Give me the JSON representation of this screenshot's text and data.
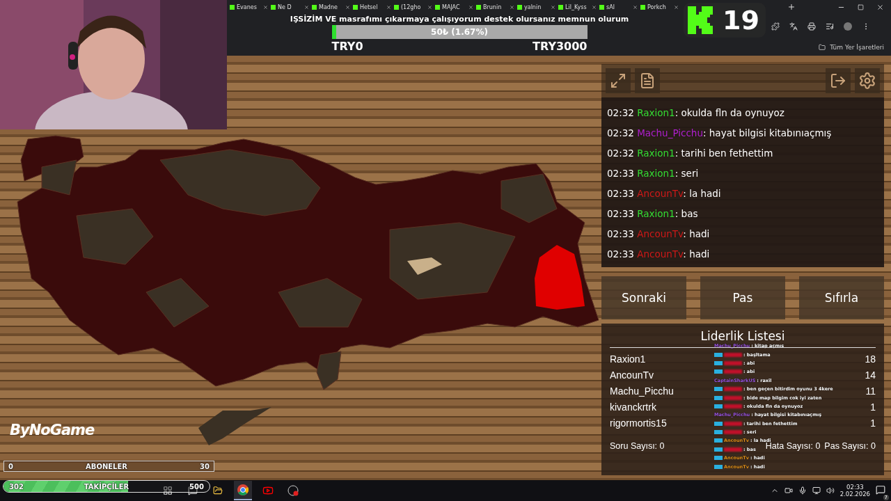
{
  "browser": {
    "tabs": [
      {
        "label": "Evanes"
      },
      {
        "label": "Ne D"
      },
      {
        "label": "Madne"
      },
      {
        "label": "Hetsel"
      },
      {
        "label": "(12gho"
      },
      {
        "label": "MAJAC"
      },
      {
        "label": "Brunin"
      },
      {
        "label": "yalnin"
      },
      {
        "label": "Lil_Kyss"
      },
      {
        "label": "sAl"
      },
      {
        "label": "Porkch"
      }
    ],
    "bookmarks": "Tüm Yer İşaretleri"
  },
  "donation": {
    "title": "IŞSİZİM VE masrafımı çıkarmaya çalışıyorum destek olursanız memnun olurum",
    "reading": "50₺ (1.67%)",
    "level": 0.0167,
    "min": "TRY0",
    "max": "TRY3000"
  },
  "viewer_badge": {
    "count": "19"
  },
  "chat": [
    {
      "time": "02:32",
      "user": "Raxion1",
      "color": "#33dd33",
      "text": ": okulda fln da oynuyoz"
    },
    {
      "time": "02:32",
      "user": "Machu_Picchu",
      "color": "#b01fd0",
      "text": ": hayat bilgisi kitabınıaçmış"
    },
    {
      "time": "02:32",
      "user": "Raxion1",
      "color": "#33dd33",
      "text": ": tarihi ben fethettim"
    },
    {
      "time": "02:33",
      "user": "Raxion1",
      "color": "#33dd33",
      "text": ": seri"
    },
    {
      "time": "02:33",
      "user": "AncounTv",
      "color": "#d01818",
      "text": ": la hadi"
    },
    {
      "time": "02:33",
      "user": "Raxion1",
      "color": "#33dd33",
      "text": ": bas"
    },
    {
      "time": "02:33",
      "user": "AncounTv",
      "color": "#d01818",
      "text": ": hadi"
    },
    {
      "time": "02:33",
      "user": "AncounTv",
      "color": "#d01818",
      "text": ": hadi"
    }
  ],
  "buttons": [
    "Sonraki",
    "Pas",
    "Sıfırla"
  ],
  "leaderboard": {
    "title": "Liderlik Listesi",
    "rows": [
      {
        "name": "Raxion1",
        "score": "18"
      },
      {
        "name": "AncounTv",
        "score": "14"
      },
      {
        "name": "Machu_Picchu",
        "score": "11"
      },
      {
        "name": "kivanckrtrk",
        "score": "1"
      },
      {
        "name": "rigormortis15",
        "score": "1"
      }
    ],
    "stats": [
      "Soru Sayısı: 0",
      "Hata Sayısı: 0",
      "Pas Sayısı: 0"
    ]
  },
  "stream_chat": [
    {
      "user": "Machu_Picchu",
      "hidden": false,
      "color": "#9a55e0",
      "badge": false,
      "text": ": kitap açmıs"
    },
    {
      "hidden": true,
      "color": "#c0102a",
      "badge": true,
      "text": ": başltama"
    },
    {
      "hidden": true,
      "color": "#c0102a",
      "badge": true,
      "text": ": abi"
    },
    {
      "hidden": true,
      "color": "#c0102a",
      "badge": true,
      "text": ": abi"
    },
    {
      "user": "CaptainSharkUS",
      "hidden": false,
      "color": "#9a55e0",
      "badge": false,
      "text": ": raxil"
    },
    {
      "hidden": true,
      "color": "#c0102a",
      "badge": true,
      "text": ": ben geçen bitirdim oyunu 3 4kere"
    },
    {
      "hidden": true,
      "color": "#c0102a",
      "badge": true,
      "text": ": bide map bilgim cok iyi zaten"
    },
    {
      "hidden": true,
      "color": "#c0102a",
      "badge": true,
      "text": ": okulda fln da oynuyoz"
    },
    {
      "user": "Machu_Picchu",
      "hidden": false,
      "color": "#9a55e0",
      "badge": false,
      "text": ": hayat bilgisi kitabınıaçmış"
    },
    {
      "hidden": true,
      "color": "#c0102a",
      "badge": true,
      "text": ": tarihi ben fethettim"
    },
    {
      "hidden": true,
      "color": "#c0102a",
      "badge": true,
      "text": ": seri"
    },
    {
      "user": "AncounTv",
      "hidden": false,
      "color": "#e0901a",
      "badge": true,
      "text": ": la hadi"
    },
    {
      "hidden": true,
      "color": "#c0102a",
      "badge": true,
      "text": ": bas"
    },
    {
      "user": "AncounTv",
      "hidden": false,
      "color": "#e0901a",
      "badge": true,
      "text": ": hadi"
    },
    {
      "user": "AncounTv",
      "hidden": false,
      "color": "#e0901a",
      "badge": true,
      "text": ": hadi"
    }
  ],
  "logo": "ByNoGame",
  "subscribers": {
    "min": "0",
    "label": "ABONELER",
    "max": "30",
    "level": 0
  },
  "followers": {
    "current": "302",
    "label": "TAKİPÇİLER",
    "max": "500",
    "level": 0.604
  },
  "taskbar": {
    "time": "02:33",
    "date": "2.02.2026",
    "notifications": "7"
  }
}
